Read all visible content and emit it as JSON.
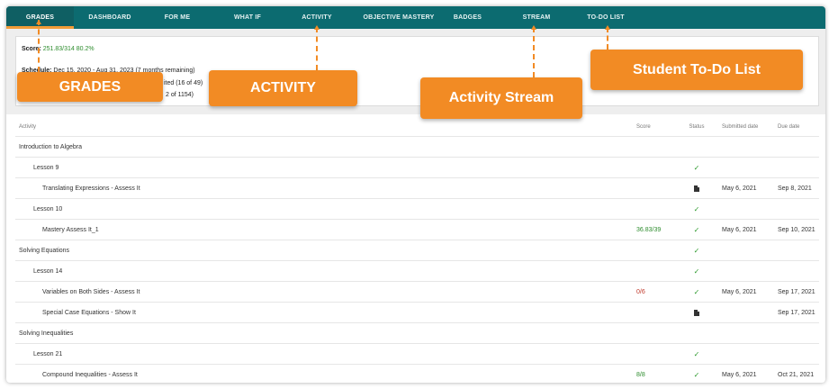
{
  "nav": {
    "tabs": [
      "GRADES",
      "DASHBOARD",
      "FOR ME",
      "WHAT IF",
      "ACTIVITY",
      "OBJECTIVE MASTERY",
      "BADGES",
      "STREAM",
      "TO-DO LIST"
    ],
    "active": "GRADES"
  },
  "summary": {
    "score_label": "Score:",
    "score_value": "251.83/314 80.2%",
    "schedule_label": "Schedule:",
    "schedule_value": "Dec 15, 2020 - Aug 31, 2023 (7 months remaining)",
    "progress_partial": "ited (16 of 49)",
    "count_partial": "2 of 1154)"
  },
  "table": {
    "headers": {
      "activity": "Activity",
      "score": "Score",
      "status": "Status",
      "submitted": "Submitted date",
      "due": "Due date"
    },
    "rows": [
      {
        "label": "Introduction to Algebra",
        "level": 0,
        "score": "",
        "score_color": "",
        "status": "",
        "submitted": "",
        "due": ""
      },
      {
        "label": "Lesson 9",
        "level": 1,
        "score": "",
        "score_color": "",
        "status": "check",
        "submitted": "",
        "due": ""
      },
      {
        "label": "Translating Expressions - Assess It",
        "level": 2,
        "score": "",
        "score_color": "",
        "status": "doc",
        "submitted": "May 6, 2021",
        "due": "Sep 8, 2021"
      },
      {
        "label": "Lesson 10",
        "level": 1,
        "score": "",
        "score_color": "",
        "status": "check",
        "submitted": "",
        "due": ""
      },
      {
        "label": "Mastery Assess It_1",
        "level": 2,
        "score": "36.83/39",
        "score_color": "green",
        "status": "check",
        "submitted": "May 6, 2021",
        "due": "Sep 10, 2021"
      },
      {
        "label": "Solving Equations",
        "level": 0,
        "score": "",
        "score_color": "",
        "status": "check",
        "submitted": "",
        "due": ""
      },
      {
        "label": "Lesson 14",
        "level": 1,
        "score": "",
        "score_color": "",
        "status": "check",
        "submitted": "",
        "due": ""
      },
      {
        "label": "Variables on Both Sides - Assess It",
        "level": 2,
        "score": "0/6",
        "score_color": "red",
        "status": "check",
        "submitted": "May 6, 2021",
        "due": "Sep 17, 2021"
      },
      {
        "label": "Special Case Equations - Show It",
        "level": 2,
        "score": "",
        "score_color": "",
        "status": "doc",
        "submitted": "",
        "due": "Sep 17, 2021"
      },
      {
        "label": "Solving Inequalities",
        "level": 0,
        "score": "",
        "score_color": "",
        "status": "",
        "submitted": "",
        "due": ""
      },
      {
        "label": "Lesson 21",
        "level": 1,
        "score": "",
        "score_color": "",
        "status": "check",
        "submitted": "",
        "due": ""
      },
      {
        "label": "Compound Inequalities - Assess It",
        "level": 2,
        "score": "8/8",
        "score_color": "green",
        "status": "check",
        "submitted": "May 6, 2021",
        "due": "Oct 21, 2021"
      }
    ]
  },
  "callouts": {
    "grades": "GRADES",
    "activity": "ACTIVITY",
    "stream": "Activity Stream",
    "todo": "Student To-Do List"
  },
  "colors": {
    "nav_bg": "#0c6b70",
    "accent": "#f28b24",
    "score_good": "#2d8c2d",
    "score_bad": "#c0392b"
  },
  "icons": {
    "check": "check-icon",
    "doc": "document-icon"
  }
}
